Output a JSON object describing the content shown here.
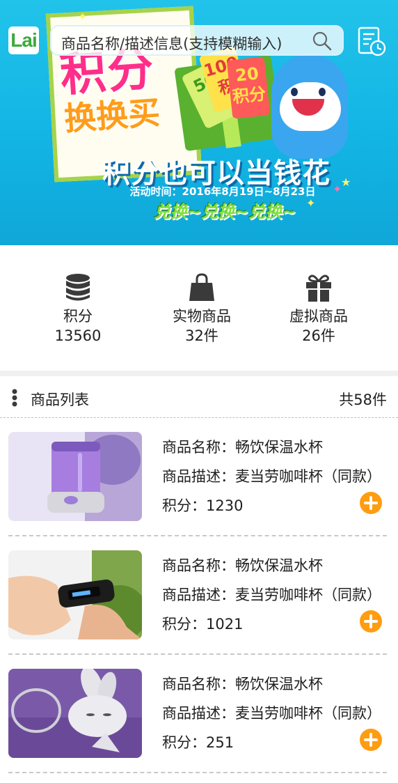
{
  "header": {
    "logo_text": "Lai",
    "search_placeholder": "商品名称/描述信息(支持模糊输入)"
  },
  "banner": {
    "title_main": "积分",
    "title_sub": "换换买",
    "coupon_labels": [
      "100积",
      "20积分",
      "50"
    ],
    "slogan": "积分也可以当钱花",
    "date_text": "活动时间：2016年8月19日~8月23日",
    "exchange_text": "兑换~兑换~兑换~"
  },
  "stats": [
    {
      "icon": "database-icon",
      "label": "积分",
      "value": "13560"
    },
    {
      "icon": "shopping-bag-icon",
      "label": "实物商品",
      "value": "32件"
    },
    {
      "icon": "gift-icon",
      "label": "虚拟商品",
      "value": "26件"
    }
  ],
  "list": {
    "title": "商品列表",
    "count": "共58件"
  },
  "products": [
    {
      "name": "商品名称：畅饮保温水杯",
      "desc": "商品描述：麦当劳咖啡杯（同款）",
      "points": "积分：1230",
      "image": "humidifier-image"
    },
    {
      "name": "商品名称：畅饮保温水杯",
      "desc": "商品描述：麦当劳咖啡杯（同款）",
      "points": "积分：1021",
      "image": "smart-band-image"
    },
    {
      "name": "商品名称：畅饮保温水杯",
      "desc": "商品描述：麦当劳咖啡杯（同款）",
      "points": "积分：251",
      "image": "rabbit-keychain-image"
    }
  ],
  "colors": {
    "banner_bg": "#1ab9e6",
    "accent_orange": "#ff9c10",
    "text_dark": "#202020",
    "divider": "#c8c8c8"
  }
}
